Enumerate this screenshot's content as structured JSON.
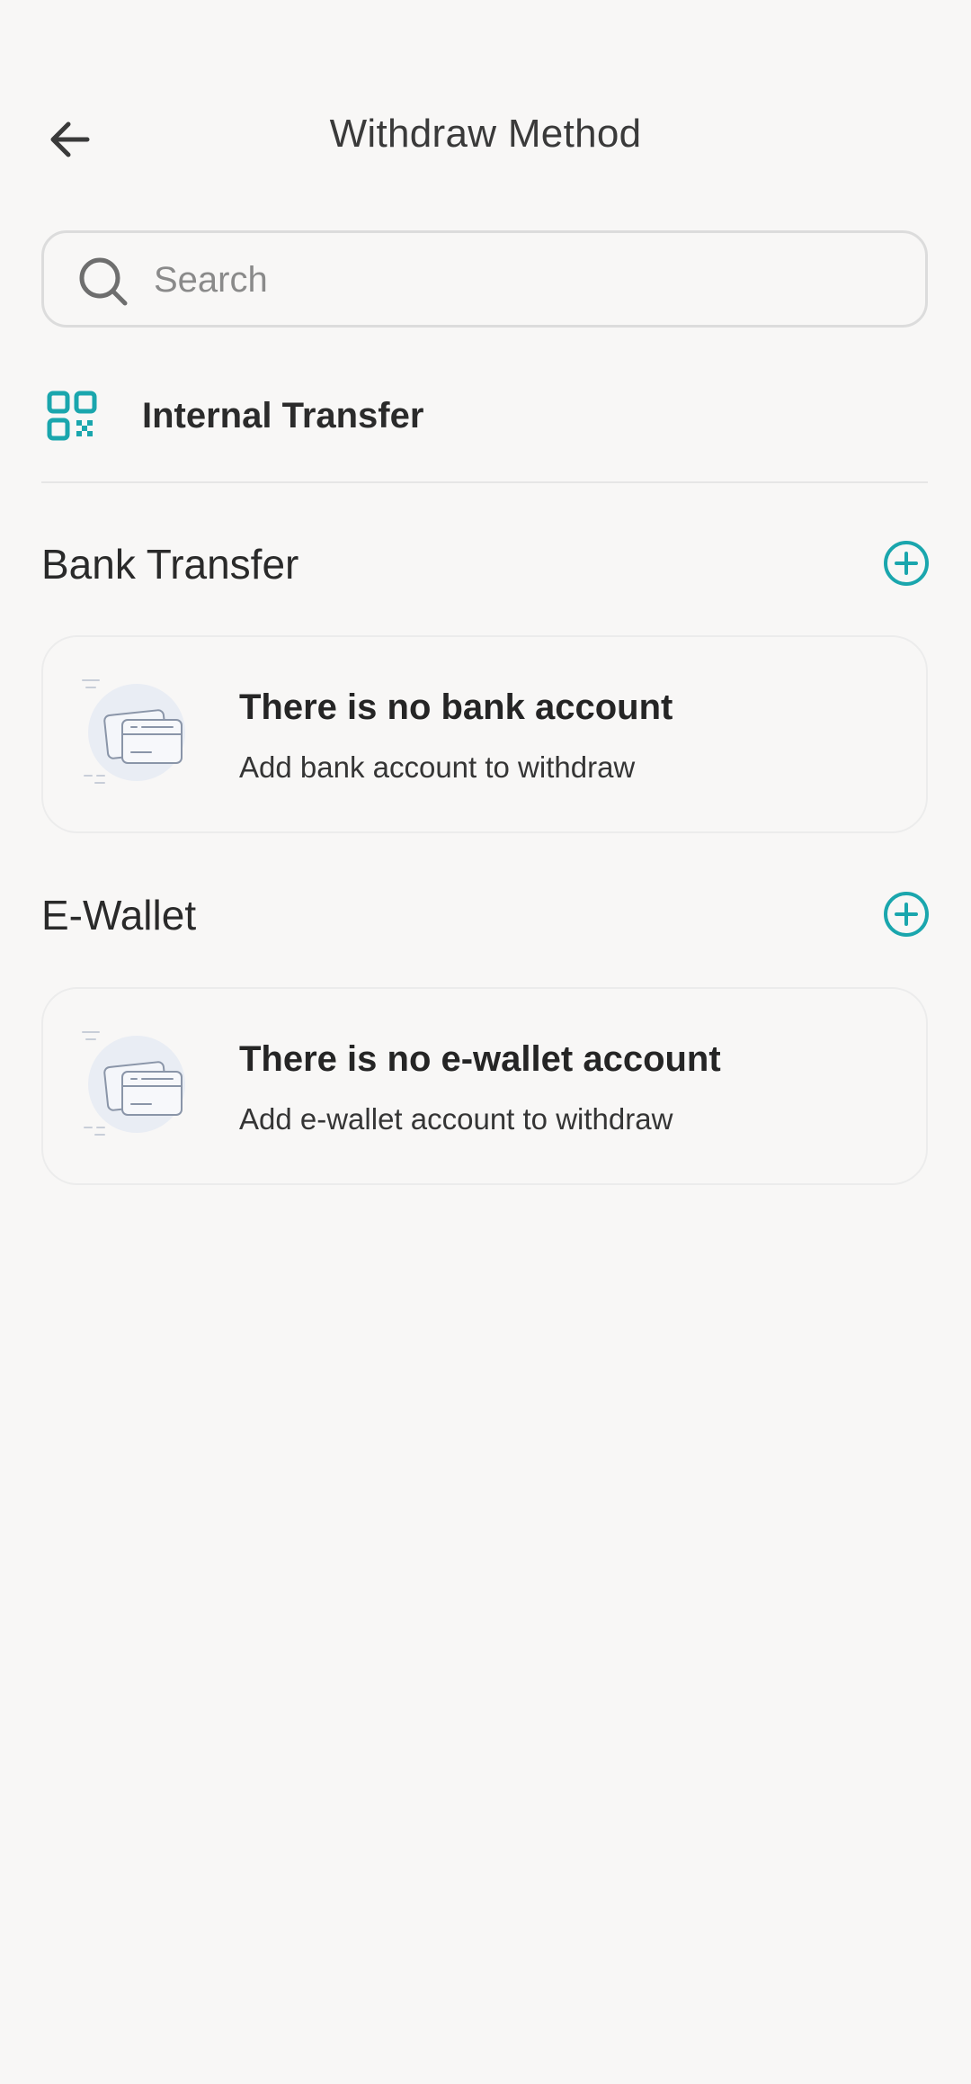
{
  "header": {
    "title": "Withdraw Method"
  },
  "search": {
    "placeholder": "Search",
    "value": ""
  },
  "internal_transfer": {
    "label": "Internal Transfer"
  },
  "sections": {
    "bank": {
      "title": "Bank Transfer",
      "empty_title": "There is no bank account",
      "empty_subtitle": "Add bank account to withdraw"
    },
    "ewallet": {
      "title": "E-Wallet",
      "empty_title": "There is no e-wallet account",
      "empty_subtitle": "Add e-wallet account to withdraw"
    }
  },
  "colors": {
    "accent": "#1aa6ad",
    "background": "#f8f7f6",
    "text": "#2a2a2a"
  },
  "icons": {
    "back": "arrow-left-icon",
    "search": "search-icon",
    "internal": "qr-code-icon",
    "add": "plus-circle-icon",
    "empty": "card-illustration-icon"
  }
}
